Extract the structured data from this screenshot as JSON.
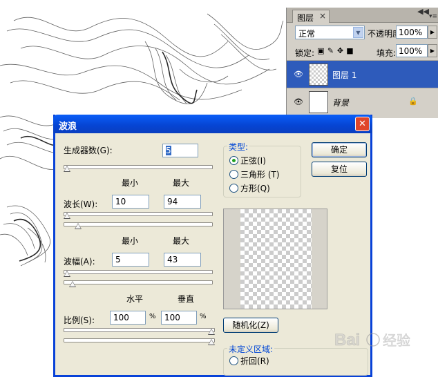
{
  "layers_panel": {
    "tab_label": "图层",
    "close_glyph": "×",
    "blend_mode": "正常",
    "opacity_label": "不透明度:",
    "opacity_value": "100%",
    "lock_label": "锁定:",
    "fill_label": "填充:",
    "fill_value": "100%",
    "layers": [
      {
        "name": "图层 1",
        "selected": true
      },
      {
        "name": "背景",
        "selected": false,
        "locked": true
      }
    ]
  },
  "dialog": {
    "title": "波浪",
    "close_glyph": "✕",
    "generators_label": "生成器数(G):",
    "generators_value": "5",
    "min_label": "最小",
    "max_label": "最大",
    "wavelength_label": "波长(W):",
    "wavelength_min": "10",
    "wavelength_max": "94",
    "amplitude_label": "波幅(A):",
    "amplitude_min": "5",
    "amplitude_max": "43",
    "horizontal_label": "水平",
    "vertical_label": "垂直",
    "scale_label": "比例(S):",
    "scale_horizontal": "100",
    "scale_vertical": "100",
    "percent": "%",
    "type_legend": "类型:",
    "type_options": [
      "正弦(I)",
      "三角形 (T)",
      "方形(Q)"
    ],
    "type_selected": 0,
    "ok_label": "确定",
    "reset_label": "复位",
    "randomize_label": "随机化(Z)",
    "undefined_legend": "未定义区域:",
    "wrap_label": "折回(R)"
  },
  "sliders": {
    "generators": 0.0,
    "wavelength_min": 0.0,
    "wavelength_max": 0.08,
    "amplitude_min": 0.0,
    "amplitude_max": 0.04,
    "scale_horizontal": 1.0,
    "scale_vertical": 1.0
  },
  "watermark": {
    "brand": "Bai",
    "suffix": "经验"
  },
  "colors": {
    "title_bar": "#0a5ef7",
    "selection": "#2e5bbb",
    "dialog_bg": "#ece9d8"
  }
}
